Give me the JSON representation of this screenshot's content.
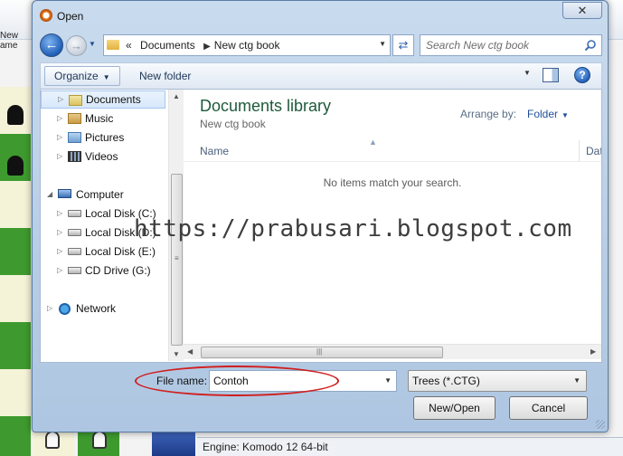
{
  "background_app": {
    "new_game_label": "New ame",
    "engine_status": "Engine: Komodo 12 64-bit",
    "colors": {
      "board_dark": "#3e9a2e",
      "board_light": "#f4f3d8"
    }
  },
  "dialog": {
    "title": "Open",
    "close_label": "✕",
    "app_icon": "app-icon"
  },
  "navigation": {
    "back_icon": "back-arrow-icon",
    "forward_icon": "forward-arrow-icon",
    "breadcrumb": {
      "lead": "«",
      "items": [
        "Documents",
        "New ctg book"
      ]
    },
    "search_placeholder": "Search New ctg book"
  },
  "toolbar": {
    "organize_label": "Organize",
    "new_folder_label": "New folder"
  },
  "nav_pane": {
    "items": [
      {
        "label": "Documents",
        "icon": "documents-icon",
        "selected": true
      },
      {
        "label": "Music",
        "icon": "music-icon"
      },
      {
        "label": "Pictures",
        "icon": "pictures-icon"
      },
      {
        "label": "Videos",
        "icon": "videos-icon"
      },
      {
        "label": "Computer",
        "icon": "computer-icon"
      },
      {
        "label": "Local Disk (C:)",
        "icon": "local-disk-icon"
      },
      {
        "label": "Local Disk (D:)",
        "icon": "local-disk-icon"
      },
      {
        "label": "Local Disk (E:)",
        "icon": "local-disk-icon"
      },
      {
        "label": "CD Drive (G:)",
        "icon": "cd-drive-icon"
      },
      {
        "label": "Network",
        "icon": "network-icon"
      }
    ]
  },
  "file_pane": {
    "library_title": "Documents library",
    "library_subtitle": "New ctg book",
    "arrange_by_label": "Arrange by:",
    "arrange_by_value": "Folder",
    "columns": [
      "Name",
      "Date mod"
    ],
    "empty_message": "No items match your search.",
    "title_color": "#1e5a3a"
  },
  "watermark": "https://prabusari.blogspot.com",
  "bottom": {
    "file_name_label": "File name:",
    "file_name_value": "Contoh",
    "file_type_value": "Trees (*.CTG)",
    "open_button": "New/Open",
    "cancel_button": "Cancel",
    "highlight_color": "#d01e1e"
  }
}
